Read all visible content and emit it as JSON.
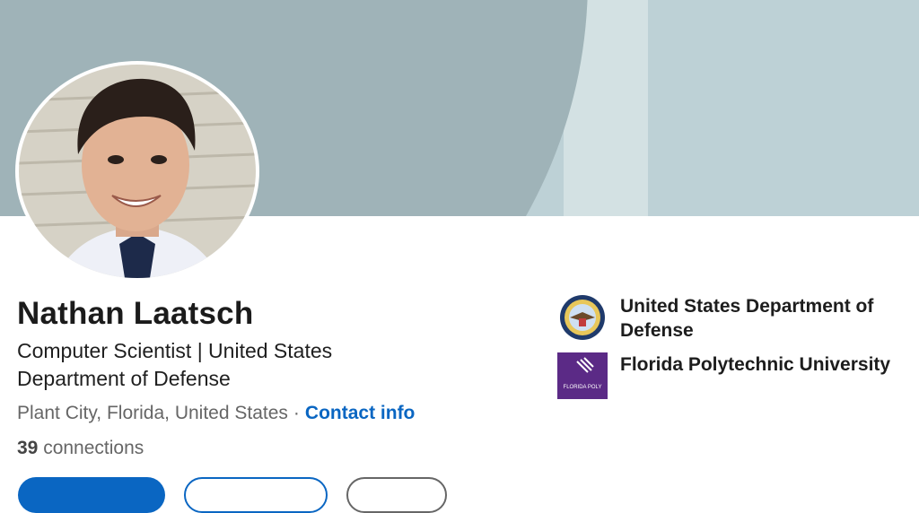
{
  "profile": {
    "name": "Nathan Laatsch",
    "headline": "Computer Scientist | United States Department of Defense",
    "location": "Plant City, Florida, United States",
    "separator": "·",
    "contact_label": "Contact info",
    "connections_count": "39",
    "connections_label": "connections"
  },
  "organizations": [
    {
      "name": "United States Department of Defense",
      "logo": "dod-seal-icon"
    },
    {
      "name": "Florida Polytechnic University",
      "logo": "florida-poly-logo",
      "logo_text": "FLORIDA POLY"
    }
  ],
  "colors": {
    "accent": "#0a66c2",
    "banner_dark": "#9fb3b8",
    "banner_light": "#bdd1d6",
    "poly_purple": "#5b2a86"
  }
}
